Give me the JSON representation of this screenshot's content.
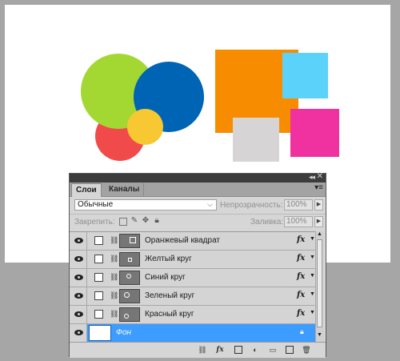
{
  "canvas": {
    "shapes": [
      {
        "name": "red-circle",
        "color": "#f04a4a"
      },
      {
        "name": "green-circle",
        "color": "#a3d833"
      },
      {
        "name": "blue-circle",
        "color": "#0064b4"
      },
      {
        "name": "yellow-circle",
        "color": "#f8c832"
      },
      {
        "name": "orange-square",
        "color": "#f88c00"
      },
      {
        "name": "light-blue-square",
        "color": "#5ad2fa"
      },
      {
        "name": "gray-square",
        "color": "#d6d4d4"
      },
      {
        "name": "pink-square",
        "color": "#f032a0"
      }
    ]
  },
  "panel": {
    "tabs": {
      "layers": "Слои",
      "channels": "Каналы"
    },
    "collapse_icon": "double-chevron",
    "blend_mode": "Обычные",
    "opacity_label": "Непрозрачность:",
    "opacity_value": "100%",
    "lock_label": "Закрепить:",
    "fill_label": "Заливка:",
    "fill_value": "100%",
    "layers": [
      {
        "name": "Оранжевый квадрат",
        "fx": "fx"
      },
      {
        "name": "Желтый круг",
        "fx": "fx"
      },
      {
        "name": "Синий круг",
        "fx": "fx"
      },
      {
        "name": "Зеленый круг",
        "fx": "fx"
      },
      {
        "name": "Красный круг",
        "fx": "fx"
      },
      {
        "name": "Фон",
        "selected": true,
        "locked": true
      }
    ],
    "bottom_icons": [
      "link-icon",
      "fx-icon",
      "mask-icon",
      "adjustment-icon",
      "folder-icon",
      "new-layer-icon",
      "trash-icon"
    ],
    "fx_button": "fx",
    "selected_color": "#3c9cff"
  }
}
